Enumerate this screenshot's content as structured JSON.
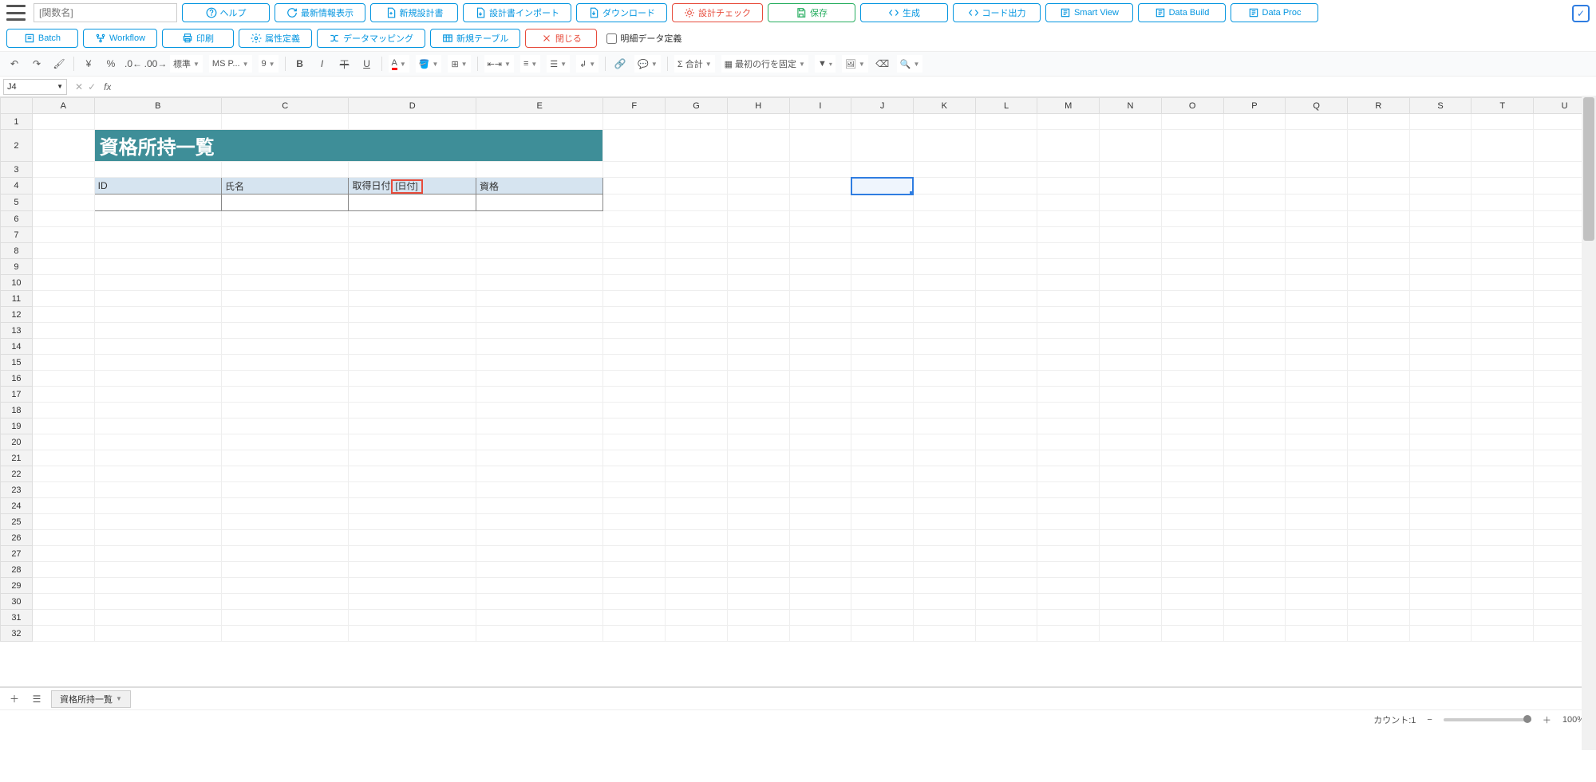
{
  "fn_placeholder": "[関数名]",
  "toolbar1": {
    "help": "ヘルプ",
    "latest": "最新情報表示",
    "newdesign": "新規設計書",
    "import": "設計書インポート",
    "download": "ダウンロード",
    "designcheck": "設計チェック",
    "save": "保存",
    "generate": "生成",
    "codeout": "コード出力",
    "smartview": "Smart View",
    "databuild": "Data Build",
    "dataproc": "Data Proc"
  },
  "toolbar2": {
    "batch": "Batch",
    "workflow": "Workflow",
    "print": "印刷",
    "attrdef": "属性定義",
    "datamapping": "データマッピング",
    "newtable": "新規テーブル",
    "close": "閉じる",
    "detail_checkbox": "明細データ定義"
  },
  "fmt": {
    "currency": "¥",
    "percent": "%",
    "std": "標準",
    "font": "MS P...",
    "size": "9",
    "sum": "Σ 合計",
    "freeze": "最初の行を固定"
  },
  "namebox": "J4",
  "fx": "fx",
  "columns": [
    "",
    "A",
    "B",
    "C",
    "D",
    "E",
    "F",
    "G",
    "H",
    "I",
    "J",
    "K",
    "L",
    "M",
    "N",
    "O",
    "P",
    "Q",
    "R",
    "S",
    "T",
    "U"
  ],
  "rows": 32,
  "sheet": {
    "title": "資格所持一覧",
    "hdr_b": "ID",
    "hdr_c": "氏名",
    "hdr_d": "取得日付",
    "hdr_d_tag": "[日付]",
    "hdr_e": "資格"
  },
  "tab_name": "資格所持一覧",
  "status": {
    "count": "カウント:1",
    "zoom": "100%"
  }
}
